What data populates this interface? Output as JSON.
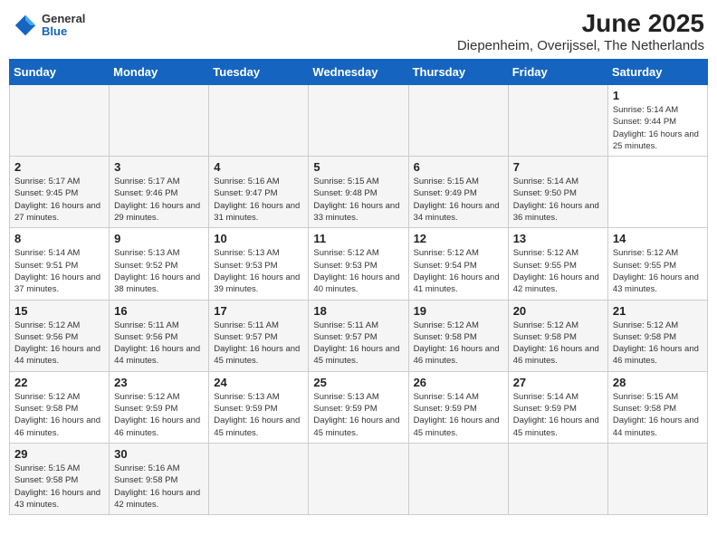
{
  "header": {
    "logo_general": "General",
    "logo_blue": "Blue",
    "title": "June 2025",
    "subtitle": "Diepenheim, Overijssel, The Netherlands"
  },
  "calendar": {
    "weekdays": [
      "Sunday",
      "Monday",
      "Tuesday",
      "Wednesday",
      "Thursday",
      "Friday",
      "Saturday"
    ],
    "weeks": [
      [
        null,
        null,
        null,
        null,
        null,
        null,
        {
          "day": 1,
          "sunrise": "5:14 AM",
          "sunset": "9:44 PM",
          "daylight": "16 hours and 25 minutes."
        }
      ],
      [
        {
          "day": 2,
          "sunrise": "5:17 AM",
          "sunset": "9:45 PM",
          "daylight": "16 hours and 27 minutes."
        },
        {
          "day": 3,
          "sunrise": "5:17 AM",
          "sunset": "9:46 PM",
          "daylight": "16 hours and 29 minutes."
        },
        {
          "day": 4,
          "sunrise": "5:16 AM",
          "sunset": "9:47 PM",
          "daylight": "16 hours and 31 minutes."
        },
        {
          "day": 5,
          "sunrise": "5:15 AM",
          "sunset": "9:48 PM",
          "daylight": "16 hours and 33 minutes."
        },
        {
          "day": 6,
          "sunrise": "5:15 AM",
          "sunset": "9:49 PM",
          "daylight": "16 hours and 34 minutes."
        },
        {
          "day": 7,
          "sunrise": "5:14 AM",
          "sunset": "9:50 PM",
          "daylight": "16 hours and 36 minutes."
        }
      ],
      [
        {
          "day": 8,
          "sunrise": "5:14 AM",
          "sunset": "9:51 PM",
          "daylight": "16 hours and 37 minutes."
        },
        {
          "day": 9,
          "sunrise": "5:13 AM",
          "sunset": "9:52 PM",
          "daylight": "16 hours and 38 minutes."
        },
        {
          "day": 10,
          "sunrise": "5:13 AM",
          "sunset": "9:53 PM",
          "daylight": "16 hours and 39 minutes."
        },
        {
          "day": 11,
          "sunrise": "5:12 AM",
          "sunset": "9:53 PM",
          "daylight": "16 hours and 40 minutes."
        },
        {
          "day": 12,
          "sunrise": "5:12 AM",
          "sunset": "9:54 PM",
          "daylight": "16 hours and 41 minutes."
        },
        {
          "day": 13,
          "sunrise": "5:12 AM",
          "sunset": "9:55 PM",
          "daylight": "16 hours and 42 minutes."
        },
        {
          "day": 14,
          "sunrise": "5:12 AM",
          "sunset": "9:55 PM",
          "daylight": "16 hours and 43 minutes."
        }
      ],
      [
        {
          "day": 15,
          "sunrise": "5:12 AM",
          "sunset": "9:56 PM",
          "daylight": "16 hours and 44 minutes."
        },
        {
          "day": 16,
          "sunrise": "5:11 AM",
          "sunset": "9:56 PM",
          "daylight": "16 hours and 44 minutes."
        },
        {
          "day": 17,
          "sunrise": "5:11 AM",
          "sunset": "9:57 PM",
          "daylight": "16 hours and 45 minutes."
        },
        {
          "day": 18,
          "sunrise": "5:11 AM",
          "sunset": "9:57 PM",
          "daylight": "16 hours and 45 minutes."
        },
        {
          "day": 19,
          "sunrise": "5:12 AM",
          "sunset": "9:58 PM",
          "daylight": "16 hours and 46 minutes."
        },
        {
          "day": 20,
          "sunrise": "5:12 AM",
          "sunset": "9:58 PM",
          "daylight": "16 hours and 46 minutes."
        },
        {
          "day": 21,
          "sunrise": "5:12 AM",
          "sunset": "9:58 PM",
          "daylight": "16 hours and 46 minutes."
        }
      ],
      [
        {
          "day": 22,
          "sunrise": "5:12 AM",
          "sunset": "9:58 PM",
          "daylight": "16 hours and 46 minutes."
        },
        {
          "day": 23,
          "sunrise": "5:12 AM",
          "sunset": "9:59 PM",
          "daylight": "16 hours and 46 minutes."
        },
        {
          "day": 24,
          "sunrise": "5:13 AM",
          "sunset": "9:59 PM",
          "daylight": "16 hours and 45 minutes."
        },
        {
          "day": 25,
          "sunrise": "5:13 AM",
          "sunset": "9:59 PM",
          "daylight": "16 hours and 45 minutes."
        },
        {
          "day": 26,
          "sunrise": "5:14 AM",
          "sunset": "9:59 PM",
          "daylight": "16 hours and 45 minutes."
        },
        {
          "day": 27,
          "sunrise": "5:14 AM",
          "sunset": "9:59 PM",
          "daylight": "16 hours and 45 minutes."
        },
        {
          "day": 28,
          "sunrise": "5:15 AM",
          "sunset": "9:58 PM",
          "daylight": "16 hours and 44 minutes."
        }
      ],
      [
        {
          "day": 29,
          "sunrise": "5:15 AM",
          "sunset": "9:58 PM",
          "daylight": "16 hours and 43 minutes."
        },
        {
          "day": 30,
          "sunrise": "5:16 AM",
          "sunset": "9:58 PM",
          "daylight": "16 hours and 42 minutes."
        },
        null,
        null,
        null,
        null,
        null
      ]
    ]
  }
}
